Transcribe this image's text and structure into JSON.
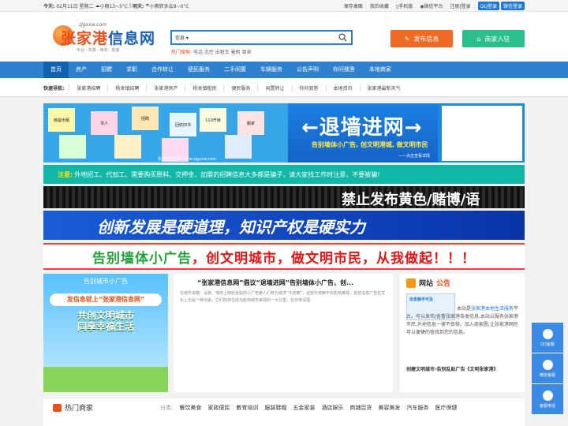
{
  "topbar": {
    "today_label": "今天:",
    "date": "02月11日 星期二",
    "today_weather": "小雨13~5°C",
    "tomorrow_label": "明天:",
    "tomorrow_weather": "小雨转多云9~0°C",
    "links": [
      "保存桌面",
      "我的收藏",
      "手机版",
      "微信平台"
    ],
    "register": "注册",
    "login": "登录",
    "qq_login": "QQ登录",
    "wechat_login": "微信登录"
  },
  "header": {
    "logo_url": "zjgxxw.com",
    "logo_text_a": "张家港",
    "logo_text_b": "信息网",
    "logo_slogan": "专业 · 实惠 · 简单 · 真诚",
    "search_select": "信息",
    "hot_label": "热门搜索:",
    "hot_keywords": "电话 北控 出租车 暑假 银泉",
    "publish": "发布信息",
    "join": "商家入驻"
  },
  "nav": [
    "首页",
    "房产",
    "招聘",
    "求职",
    "合作转让",
    "便民服务",
    "二手闲置",
    "车辆服务",
    "公告声明",
    "你问我答",
    "本地商家"
  ],
  "quick": {
    "title": "快速导航:",
    "items": [
      "张家港招聘",
      "杨舍镇招聘",
      "张家港房产",
      "杨舍镇租房",
      "便民服务",
      "闲置转让",
      "你问我答",
      "本地资讯",
      "张家港最新天气"
    ]
  },
  "banner1": {
    "title": "←退墙进网→",
    "subtitle": "告别墙体小广告, 创文明港城, 做文明市民",
    "footnote": "——点击查看详情",
    "site": "张家港信息网 www.zjgxxw.com",
    "notes": [
      "房屋出租",
      "寻人",
      "回收旧书",
      "110开锁",
      "招聘",
      "搬家"
    ]
  },
  "notice": {
    "label": "注意:",
    "text": "外地招工、代加工、需要购买原料、交押金、加盟的招聘信息大多都是骗子，请大家找工作时注意，不要被骗!"
  },
  "banner2": {
    "text": "禁止发布黄色/赌博/语"
  },
  "banner3": {
    "text": "创新发展是硬道理，知识产权是硬实力"
  },
  "banner4": {
    "part1": "告别墙体小广告",
    "part2": "，创文明城市，做文明市民，从我做起！！！"
  },
  "poster": {
    "t1": "告别城市小广告",
    "t2": "发信息就上“张家港信息网”",
    "t3a": "共创文明城市",
    "t3b": "同享幸福生活"
  },
  "news": {
    "title": "“张家港信息网”倡议“退墙进网”告别墙体小广告，创...",
    "body": "在城市道路、设施、墙体上随处张贴的小广告被人们称为城市“牛皮癣”，这些牛皮癣不仅影响美观，有些信息广告在文化上也是一种污染。它们的存在成为影响城市美观的一大公害。在日常清理"
  },
  "board": {
    "title_a": "网站",
    "title_b": "公告",
    "img_text": "信息触手可及",
    "text_a": "本站是",
    "link": "张家港本地生活服务",
    "text_b": "平台。可以发布/查看张家港各类信息,本站以服务张家港市民,外地信息一律不审核。加入商家圈,让张家港网民可以便捷的查找到您的信息。",
    "last": "创建文明城市-告别乱贴广告《文明张家港》"
  },
  "hot": {
    "title": "热门商家",
    "cat_label": "分类:",
    "cats": [
      "餐饮美食",
      "家政便民",
      "教育培训",
      "服装鞋帽",
      "五金家装",
      "酒店娱乐",
      "商铺百货",
      "美容美发",
      "汽车服务",
      "医疗保健"
    ]
  },
  "float": {
    "qq": "QQ客服",
    "wechat": "微信客服",
    "phone": "客服电话"
  }
}
